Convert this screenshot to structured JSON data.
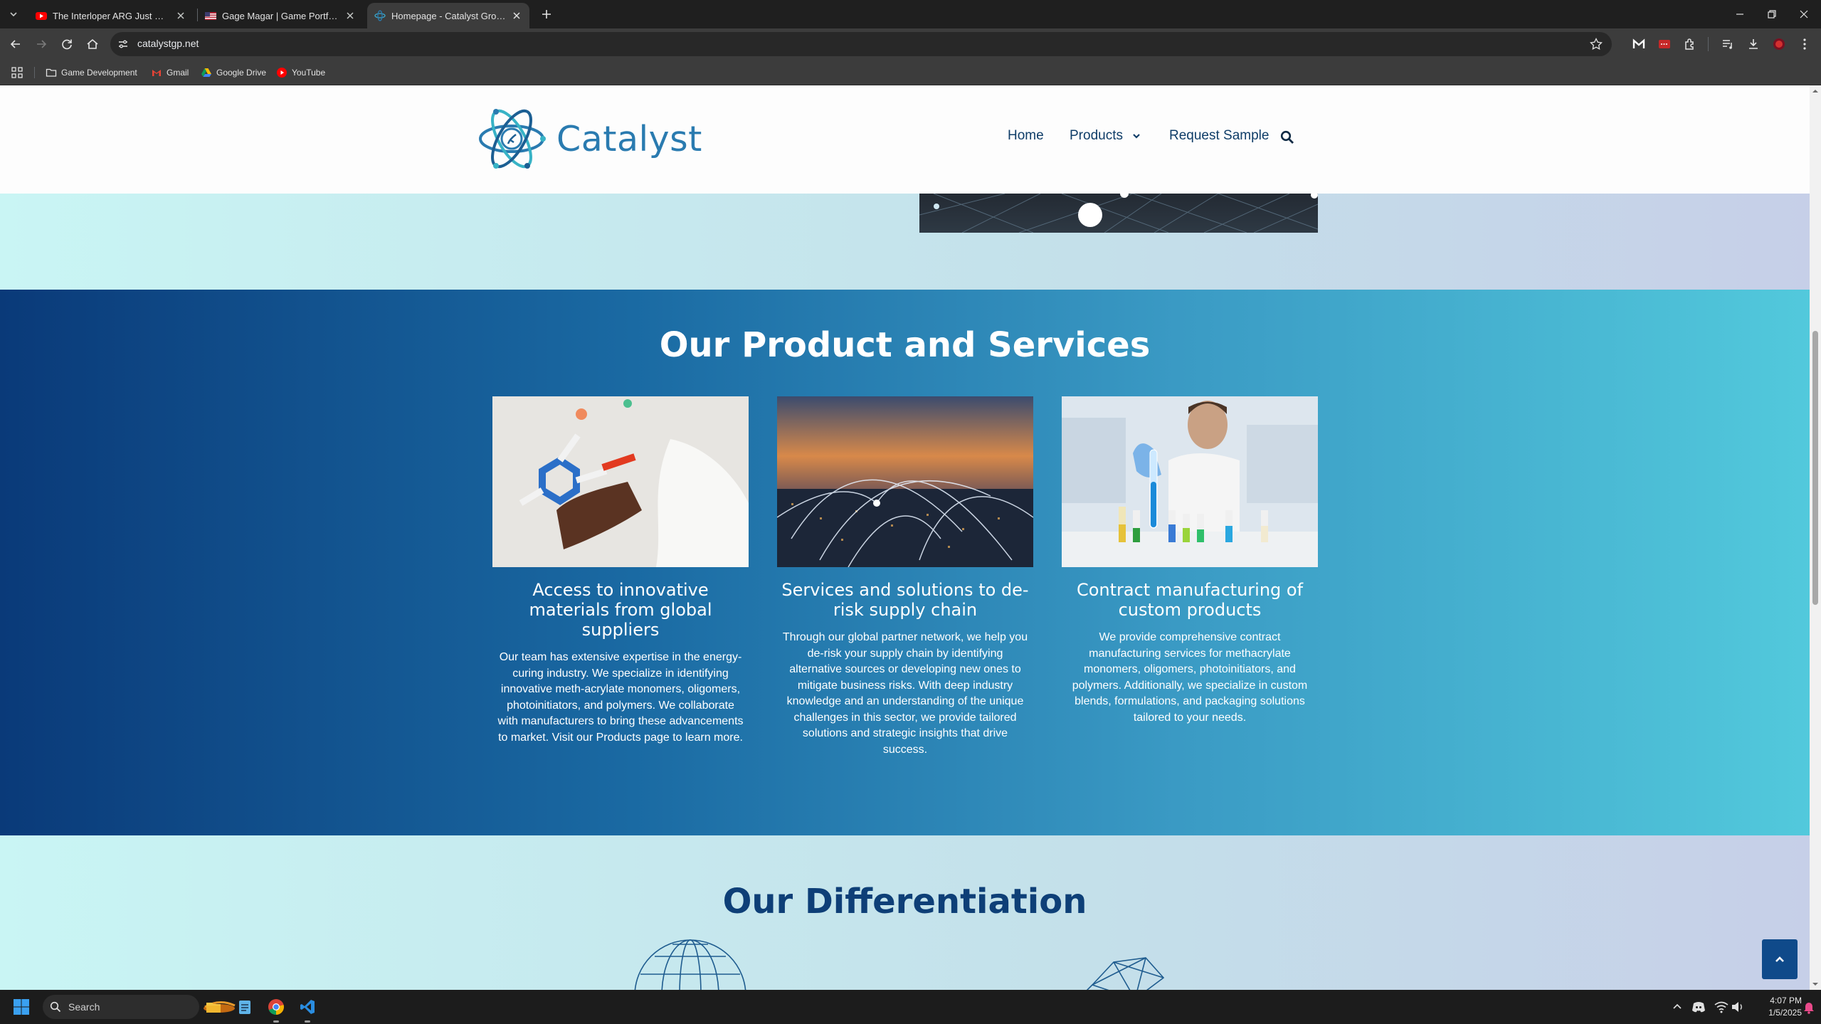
{
  "browser": {
    "tabs": [
      {
        "title": "The Interloper ARG Just Got Mo",
        "favicon": "youtube-icon",
        "active": false
      },
      {
        "title": "Gage Magar | Game Portfolio",
        "favicon": "portfolio-flag-icon",
        "active": false
      },
      {
        "title": "Homepage - Catalyst Growth Pa",
        "favicon": "catalyst-icon",
        "active": true
      }
    ],
    "url": "catalystgp.net",
    "bookmarks": [
      {
        "label": "Game Development",
        "icon": "folder-icon"
      },
      {
        "label": "Gmail",
        "icon": "gmail-icon"
      },
      {
        "label": "Google Drive",
        "icon": "drive-icon"
      },
      {
        "label": "YouTube",
        "icon": "youtube-icon"
      }
    ]
  },
  "site": {
    "logo_text": "Catalyst",
    "nav": {
      "home": "Home",
      "products": "Products",
      "request_sample": "Request Sample"
    },
    "services": {
      "title": "Our Product and Services",
      "cards": [
        {
          "title": "Access to innovative materials from global suppliers",
          "body": "Our team has extensive expertise in the energy-curing industry. We specialize in identifying innovative meth-acrylate monomers, oligomers, photoinitiators, and polymers. We collaborate with manufacturers to bring these advancements to market. Visit our Products page to learn more."
        },
        {
          "title": "Services and solutions to de-risk supply chain",
          "body": "Through our global partner network, we help you de-risk your supply chain by identifying alternative sources or developing new ones to mitigate business risks. With deep industry knowledge and an understanding of the unique challenges in this sector, we provide tailored solutions and strategic insights that drive success."
        },
        {
          "title": "Contract manufacturing of custom products",
          "body": "We provide comprehensive contract manufacturing services for methacrylate monomers, oligomers, photoinitiators, and polymers. Additionally, we specialize in custom blends, formulations, and packaging solutions tailored to your needs."
        }
      ]
    },
    "differentiation": {
      "title": "Our Differentiation"
    }
  },
  "taskbar": {
    "search_placeholder": "Search",
    "time": "4:07 PM",
    "date": "1/5/2025"
  },
  "colors": {
    "brand_blue": "#2a7bb0",
    "navy": "#0f3d68",
    "section_gradient_start": "#0a3a79",
    "section_gradient_end": "#52c9dc"
  }
}
